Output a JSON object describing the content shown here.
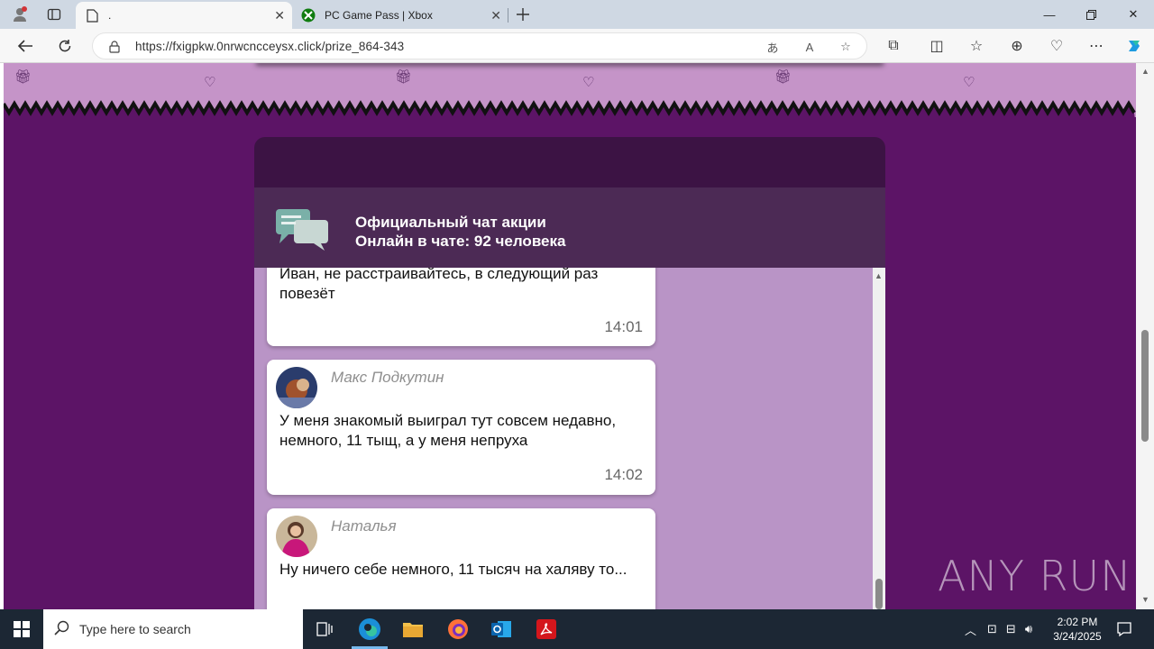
{
  "browser": {
    "tabs": [
      {
        "title": ".",
        "active": true
      },
      {
        "title": "PC Game Pass | Xbox",
        "active": false
      }
    ],
    "url": "https://fxigpkw.0nrwcncceysx.click/prize_864-343"
  },
  "chat": {
    "title": "Официальный чат акции",
    "online_label": "Онлайн в чате:",
    "online_count": "92",
    "online_suffix": "человека",
    "messages": [
      {
        "author": "",
        "text": "Иван, не расстраивайтесь, в следующий раз повезёт",
        "time": "14:01"
      },
      {
        "author": "Макс Подкутин",
        "text": "У меня знакомый выиграл тут совсем недавно, немного, 11 тыщ, а у меня непруха",
        "time": "14:02"
      },
      {
        "author": "Наталья",
        "text": "Ну ничего себе немного, 11 тысяч на халяву то...",
        "time": ""
      }
    ]
  },
  "watermark": "ANY RUN",
  "taskbar": {
    "search_placeholder": "Type here to search",
    "time": "2:02 PM",
    "date": "3/24/2025"
  },
  "colors": {
    "page_bg": "#5c1466",
    "chat_body": "#b994c6",
    "chat_header": "#4c2a55",
    "banner": "#c594c8"
  }
}
